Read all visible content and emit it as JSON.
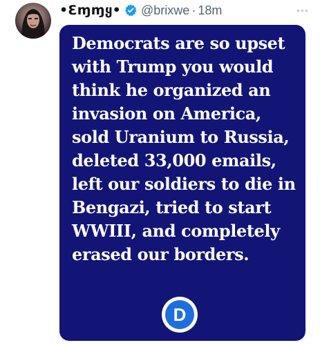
{
  "tweet": {
    "display_name": "•Ɛɱɱყ•",
    "handle": "@brixwe",
    "separator": "·",
    "time": "18m",
    "avatar_icon": "profile-avatar",
    "verified_icon": "verified-badge-icon",
    "more_icon": "more-options-icon"
  },
  "image": {
    "background_color": "#121576",
    "text": "Democrats are so upset\nwith Trump you would\nthink he organized an\ninvasion on America,\nsold Uranium to Russia,\ndeleted 33,000 emails,\nleft our soldiers to die in\nBengazi,  tried to start\nWWIII, and  completely\nerased our borders.",
    "logo_letter": "D",
    "logo_color": "#1d6fe0"
  }
}
